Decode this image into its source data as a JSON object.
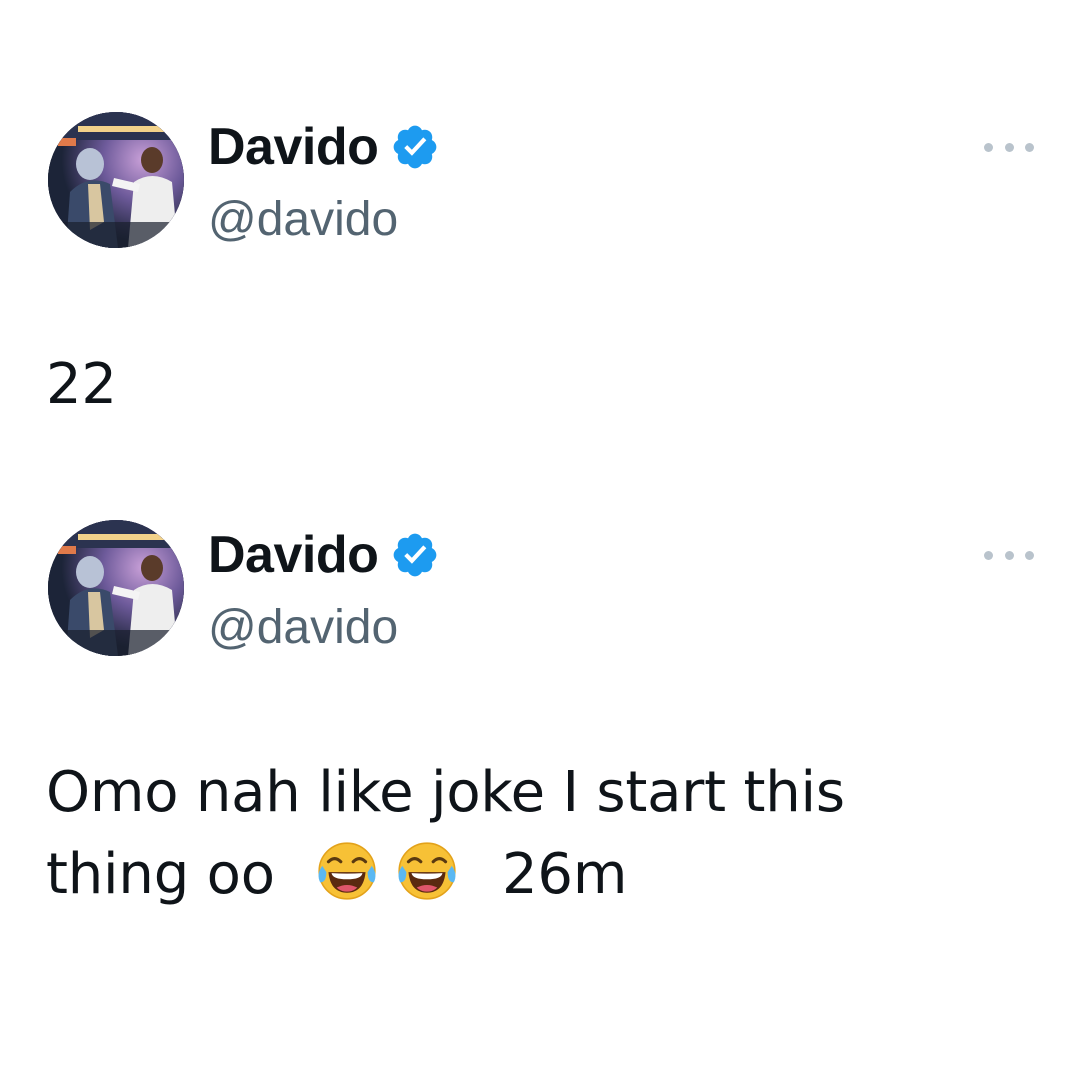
{
  "tweets": [
    {
      "author": {
        "display_name": "Davido",
        "handle": "@davido",
        "verified": true,
        "avatar_icon": "avatar-photo"
      },
      "more_icon": "more-options-icon",
      "text": "22",
      "timestamp": ""
    },
    {
      "author": {
        "display_name": "Davido",
        "handle": "@davido",
        "verified": true,
        "avatar_icon": "avatar-photo"
      },
      "more_icon": "more-options-icon",
      "text_line1": "Omo nah like joke I start this",
      "text_line2": "thing oo",
      "emojis": [
        "face-with-tears-of-joy-icon",
        "face-with-tears-of-joy-icon"
      ],
      "timestamp": "26m"
    }
  ],
  "colors": {
    "text_primary": "#0f1419",
    "text_secondary": "#536471",
    "verified_blue": "#1d9bf0",
    "more_dots": "#b9c3cc",
    "background": "#ffffff"
  }
}
